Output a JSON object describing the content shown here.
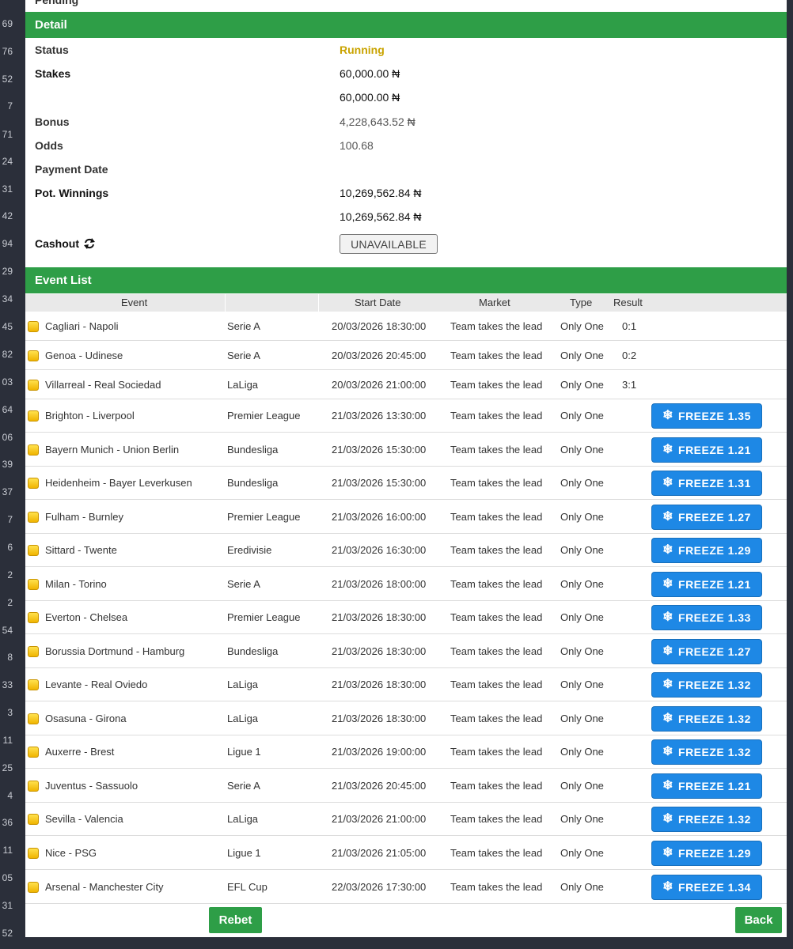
{
  "gutter_numbers": [
    "69",
    "76",
    "52",
    "7",
    "71",
    "24",
    "31",
    "42",
    "94",
    "29",
    "34",
    "45",
    "82",
    "03",
    "64",
    "06",
    "39",
    "37",
    "7",
    "6",
    "2",
    "2",
    "54",
    "8",
    "33",
    "3",
    "11",
    "25",
    "4",
    "36",
    "11",
    "05",
    "31",
    "52"
  ],
  "pending_text": "Pending",
  "detail": {
    "header": "Detail",
    "status_label": "Status",
    "status_value": "Running",
    "stakes_label": "Stakes",
    "stakes_value_1": "60,000.00 ₦",
    "stakes_value_2": "60,000.00 ₦",
    "bonus_label": "Bonus",
    "bonus_value": "4,228,643.52 ₦",
    "odds_label": "Odds",
    "odds_value": "100.68",
    "payment_date_label": "Payment Date",
    "pot_winnings_label": "Pot. Winnings",
    "pot_winnings_value_1": "10,269,562.84 ₦",
    "pot_winnings_value_2": "10,269,562.84 ₦",
    "cashout_label": "Cashout",
    "cashout_button": "UNAVAILABLE"
  },
  "event_list": {
    "header": "Event List",
    "columns": [
      "Event",
      "Start Date",
      "Market",
      "Type",
      "Result"
    ],
    "rows": [
      {
        "event": "Cagliari - Napoli",
        "league": "Serie A",
        "start": "20/03/2026 18:30:00",
        "market": "Team takes the lead",
        "type": "Only One",
        "result": "0:1",
        "freeze": ""
      },
      {
        "event": "Genoa - Udinese",
        "league": "Serie A",
        "start": "20/03/2026 20:45:00",
        "market": "Team takes the lead",
        "type": "Only One",
        "result": "0:2",
        "freeze": ""
      },
      {
        "event": "Villarreal - Real Sociedad",
        "league": "LaLiga",
        "start": "20/03/2026 21:00:00",
        "market": "Team takes the lead",
        "type": "Only One",
        "result": "3:1",
        "freeze": ""
      },
      {
        "event": "Brighton - Liverpool",
        "league": "Premier League",
        "start": "21/03/2026 13:30:00",
        "market": "Team takes the lead",
        "type": "Only One",
        "result": "",
        "freeze": "FREEZE 1.35"
      },
      {
        "event": "Bayern Munich - Union Berlin",
        "league": "Bundesliga",
        "start": "21/03/2026 15:30:00",
        "market": "Team takes the lead",
        "type": "Only One",
        "result": "",
        "freeze": "FREEZE 1.21"
      },
      {
        "event": "Heidenheim - Bayer Leverkusen",
        "league": "Bundesliga",
        "start": "21/03/2026 15:30:00",
        "market": "Team takes the lead",
        "type": "Only One",
        "result": "",
        "freeze": "FREEZE 1.31"
      },
      {
        "event": "Fulham - Burnley",
        "league": "Premier League",
        "start": "21/03/2026 16:00:00",
        "market": "Team takes the lead",
        "type": "Only One",
        "result": "",
        "freeze": "FREEZE 1.27"
      },
      {
        "event": "Sittard - Twente",
        "league": "Eredivisie",
        "start": "21/03/2026 16:30:00",
        "market": "Team takes the lead",
        "type": "Only One",
        "result": "",
        "freeze": "FREEZE 1.29"
      },
      {
        "event": "Milan - Torino",
        "league": "Serie A",
        "start": "21/03/2026 18:00:00",
        "market": "Team takes the lead",
        "type": "Only One",
        "result": "",
        "freeze": "FREEZE 1.21"
      },
      {
        "event": "Everton - Chelsea",
        "league": "Premier League",
        "start": "21/03/2026 18:30:00",
        "market": "Team takes the lead",
        "type": "Only One",
        "result": "",
        "freeze": "FREEZE 1.33"
      },
      {
        "event": "Borussia Dortmund - Hamburg",
        "league": "Bundesliga",
        "start": "21/03/2026 18:30:00",
        "market": "Team takes the lead",
        "type": "Only One",
        "result": "",
        "freeze": "FREEZE 1.27"
      },
      {
        "event": "Levante - Real Oviedo",
        "league": "LaLiga",
        "start": "21/03/2026 18:30:00",
        "market": "Team takes the lead",
        "type": "Only One",
        "result": "",
        "freeze": "FREEZE 1.32"
      },
      {
        "event": "Osasuna - Girona",
        "league": "LaLiga",
        "start": "21/03/2026 18:30:00",
        "market": "Team takes the lead",
        "type": "Only One",
        "result": "",
        "freeze": "FREEZE 1.32"
      },
      {
        "event": "Auxerre - Brest",
        "league": "Ligue 1",
        "start": "21/03/2026 19:00:00",
        "market": "Team takes the lead",
        "type": "Only One",
        "result": "",
        "freeze": "FREEZE 1.32"
      },
      {
        "event": "Juventus - Sassuolo",
        "league": "Serie A",
        "start": "21/03/2026 20:45:00",
        "market": "Team takes the lead",
        "type": "Only One",
        "result": "",
        "freeze": "FREEZE 1.21"
      },
      {
        "event": "Sevilla - Valencia",
        "league": "LaLiga",
        "start": "21/03/2026 21:00:00",
        "market": "Team takes the lead",
        "type": "Only One",
        "result": "",
        "freeze": "FREEZE 1.32"
      },
      {
        "event": "Nice - PSG",
        "league": "Ligue 1",
        "start": "21/03/2026 21:05:00",
        "market": "Team takes the lead",
        "type": "Only One",
        "result": "",
        "freeze": "FREEZE 1.29"
      },
      {
        "event": "Arsenal - Manchester City",
        "league": "EFL Cup",
        "start": "22/03/2026 17:30:00",
        "market": "Team takes the lead",
        "type": "Only One",
        "result": "",
        "freeze": "FREEZE 1.34"
      }
    ]
  },
  "footer": {
    "rebet_label": "Rebet",
    "back_label": "Back"
  },
  "colors": {
    "header_green": "#2e9e47",
    "freeze_blue": "#1e88e5",
    "running_yellow": "#c9a300",
    "gutter_bg": "#2b2f3a"
  },
  "icons": {
    "row_icon": "yellow-square-icon",
    "cashout_icon": "refresh-arrows-icon",
    "freeze_icon": "snowflake-icon"
  }
}
